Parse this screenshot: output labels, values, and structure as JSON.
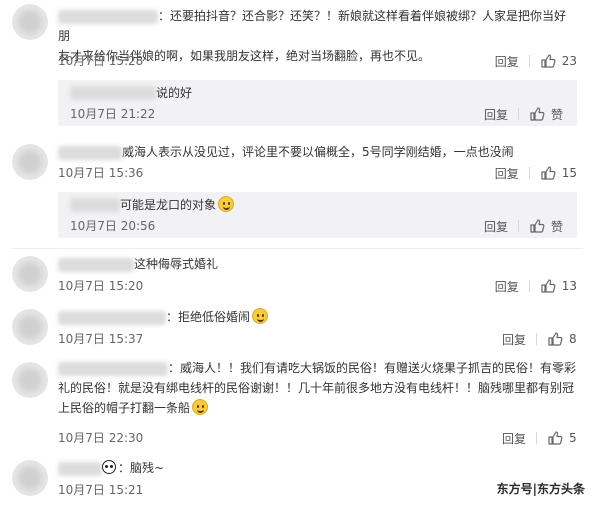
{
  "comments": [
    {
      "text_lines": [
        "：还要拍抖音？还合影？还笑？！新娘就这样看着伴娘被绑？人家是把你当好朋",
        "友才来给你当伴娘的啊，如果我朋友这样，绝对当场翻脸，再也不见。"
      ],
      "time": "10月7日 15:28",
      "reply": "回复",
      "likes": "23"
    },
    {
      "text": "说的好",
      "time": "10月7日 21:22",
      "reply": "回复",
      "likes": "赞"
    },
    {
      "text": "威海人表示从没见过，评论里不要以偏概全，5号同学刚结婚，一点也没闹",
      "time": "10月7日 15:36",
      "reply": "回复",
      "likes": "15"
    },
    {
      "text": "可能是龙口的对象",
      "time": "10月7日 20:56",
      "reply": "回复",
      "likes": "赞"
    },
    {
      "text": "这种侮辱式婚礼",
      "time": "10月7日 15:20",
      "reply": "回复",
      "likes": "13"
    },
    {
      "text": "：拒绝低俗婚闹",
      "time": "10月7日 15:37",
      "reply": "回复",
      "likes": "8"
    },
    {
      "text_lines": [
        "：威海人！！我们有请吃大锅饭的民俗！有赠送火烧果子抓吉的民俗！有零彩",
        "礼的民俗！就是没有绑电线杆的民俗谢谢！！几十年前很多地方没有电线杆！！脑残哪里都有别冠",
        "上民俗的帽子打翻一条船"
      ],
      "time": "10月7日 22:30",
      "reply": "回复",
      "likes": "5"
    },
    {
      "text": "：脑残~",
      "time": "10月7日 15:21"
    }
  ],
  "watermark": "东方号|东方头条",
  "colors": {
    "like_icon": "#666666",
    "sub_bg": "#f2f2f5"
  }
}
